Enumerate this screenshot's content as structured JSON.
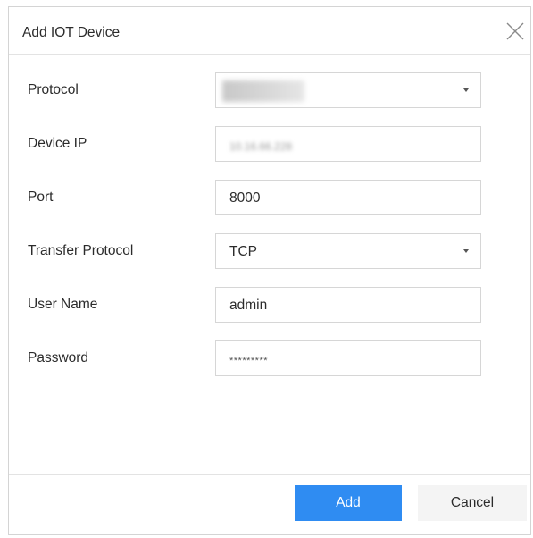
{
  "dialog": {
    "title": "Add IOT Device",
    "close_icon": "close-icon"
  },
  "form": {
    "protocol": {
      "label": "Protocol",
      "value": "",
      "icon": "chevron-down-icon"
    },
    "device_ip": {
      "label": "Device IP",
      "value": "10.16.66.228"
    },
    "port": {
      "label": "Port",
      "value": "8000"
    },
    "transfer_protocol": {
      "label": "Transfer Protocol",
      "value": "TCP",
      "icon": "chevron-down-icon"
    },
    "user_name": {
      "label": "User Name",
      "value": "admin"
    },
    "password": {
      "label": "Password",
      "value": "*********"
    }
  },
  "footer": {
    "add_label": "Add",
    "cancel_label": "Cancel"
  },
  "colors": {
    "primary_button": "#2f8cf2",
    "secondary_button": "#f4f4f4",
    "border": "#d6d6d6"
  }
}
